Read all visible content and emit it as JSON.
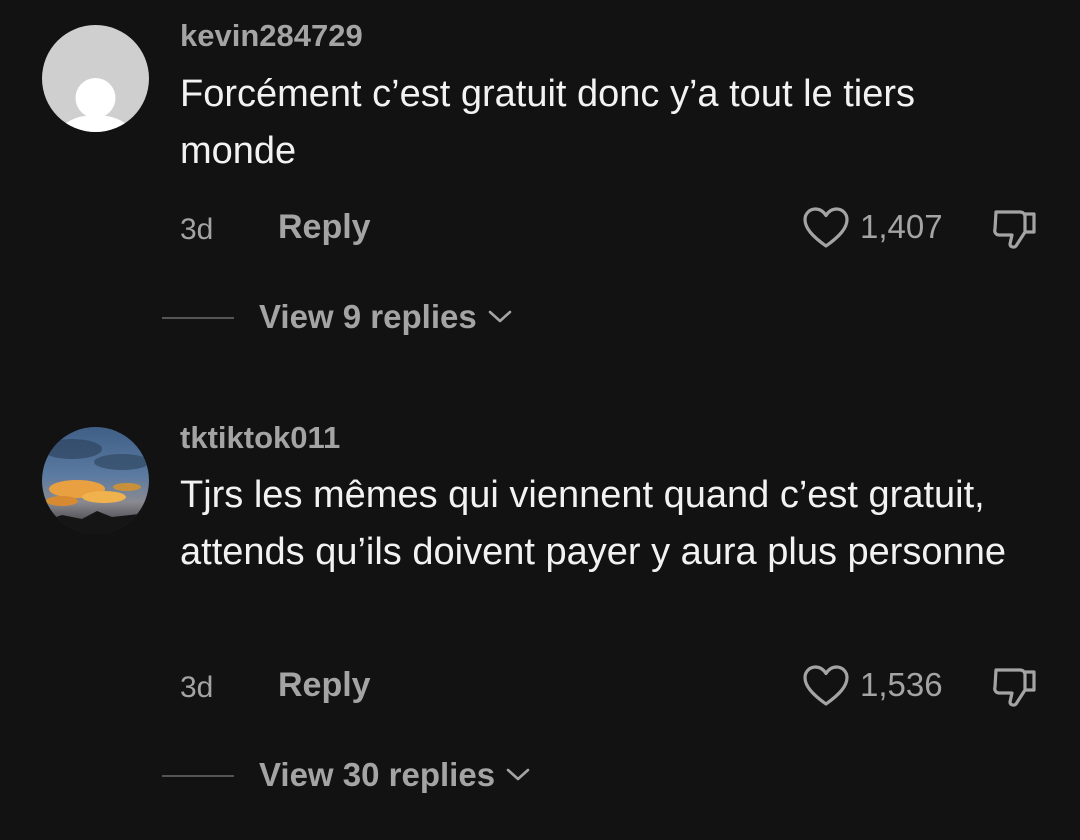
{
  "comments": [
    {
      "username": "kevin284729",
      "avatar_icon": "default-user-avatar",
      "text": "Forcément c’est gratuit donc y’a tout le tiers monde",
      "time": "3d",
      "reply_label": "Reply",
      "like_count": "1,407",
      "view_replies_label": "View 9 replies"
    },
    {
      "username": "tktiktok011",
      "avatar_icon": "sunset-sky-photo-avatar",
      "text": "Tjrs les mêmes qui viennent quand c’est gratuit, attends qu’ils doivent payer y aura plus personne",
      "time": "3d",
      "reply_label": "Reply",
      "like_count": "1,536",
      "view_replies_label": "View 30 replies"
    }
  ],
  "colors": {
    "background": "#121212",
    "muted_text": "#a4a4a4",
    "body_text": "#f2f2f2"
  }
}
